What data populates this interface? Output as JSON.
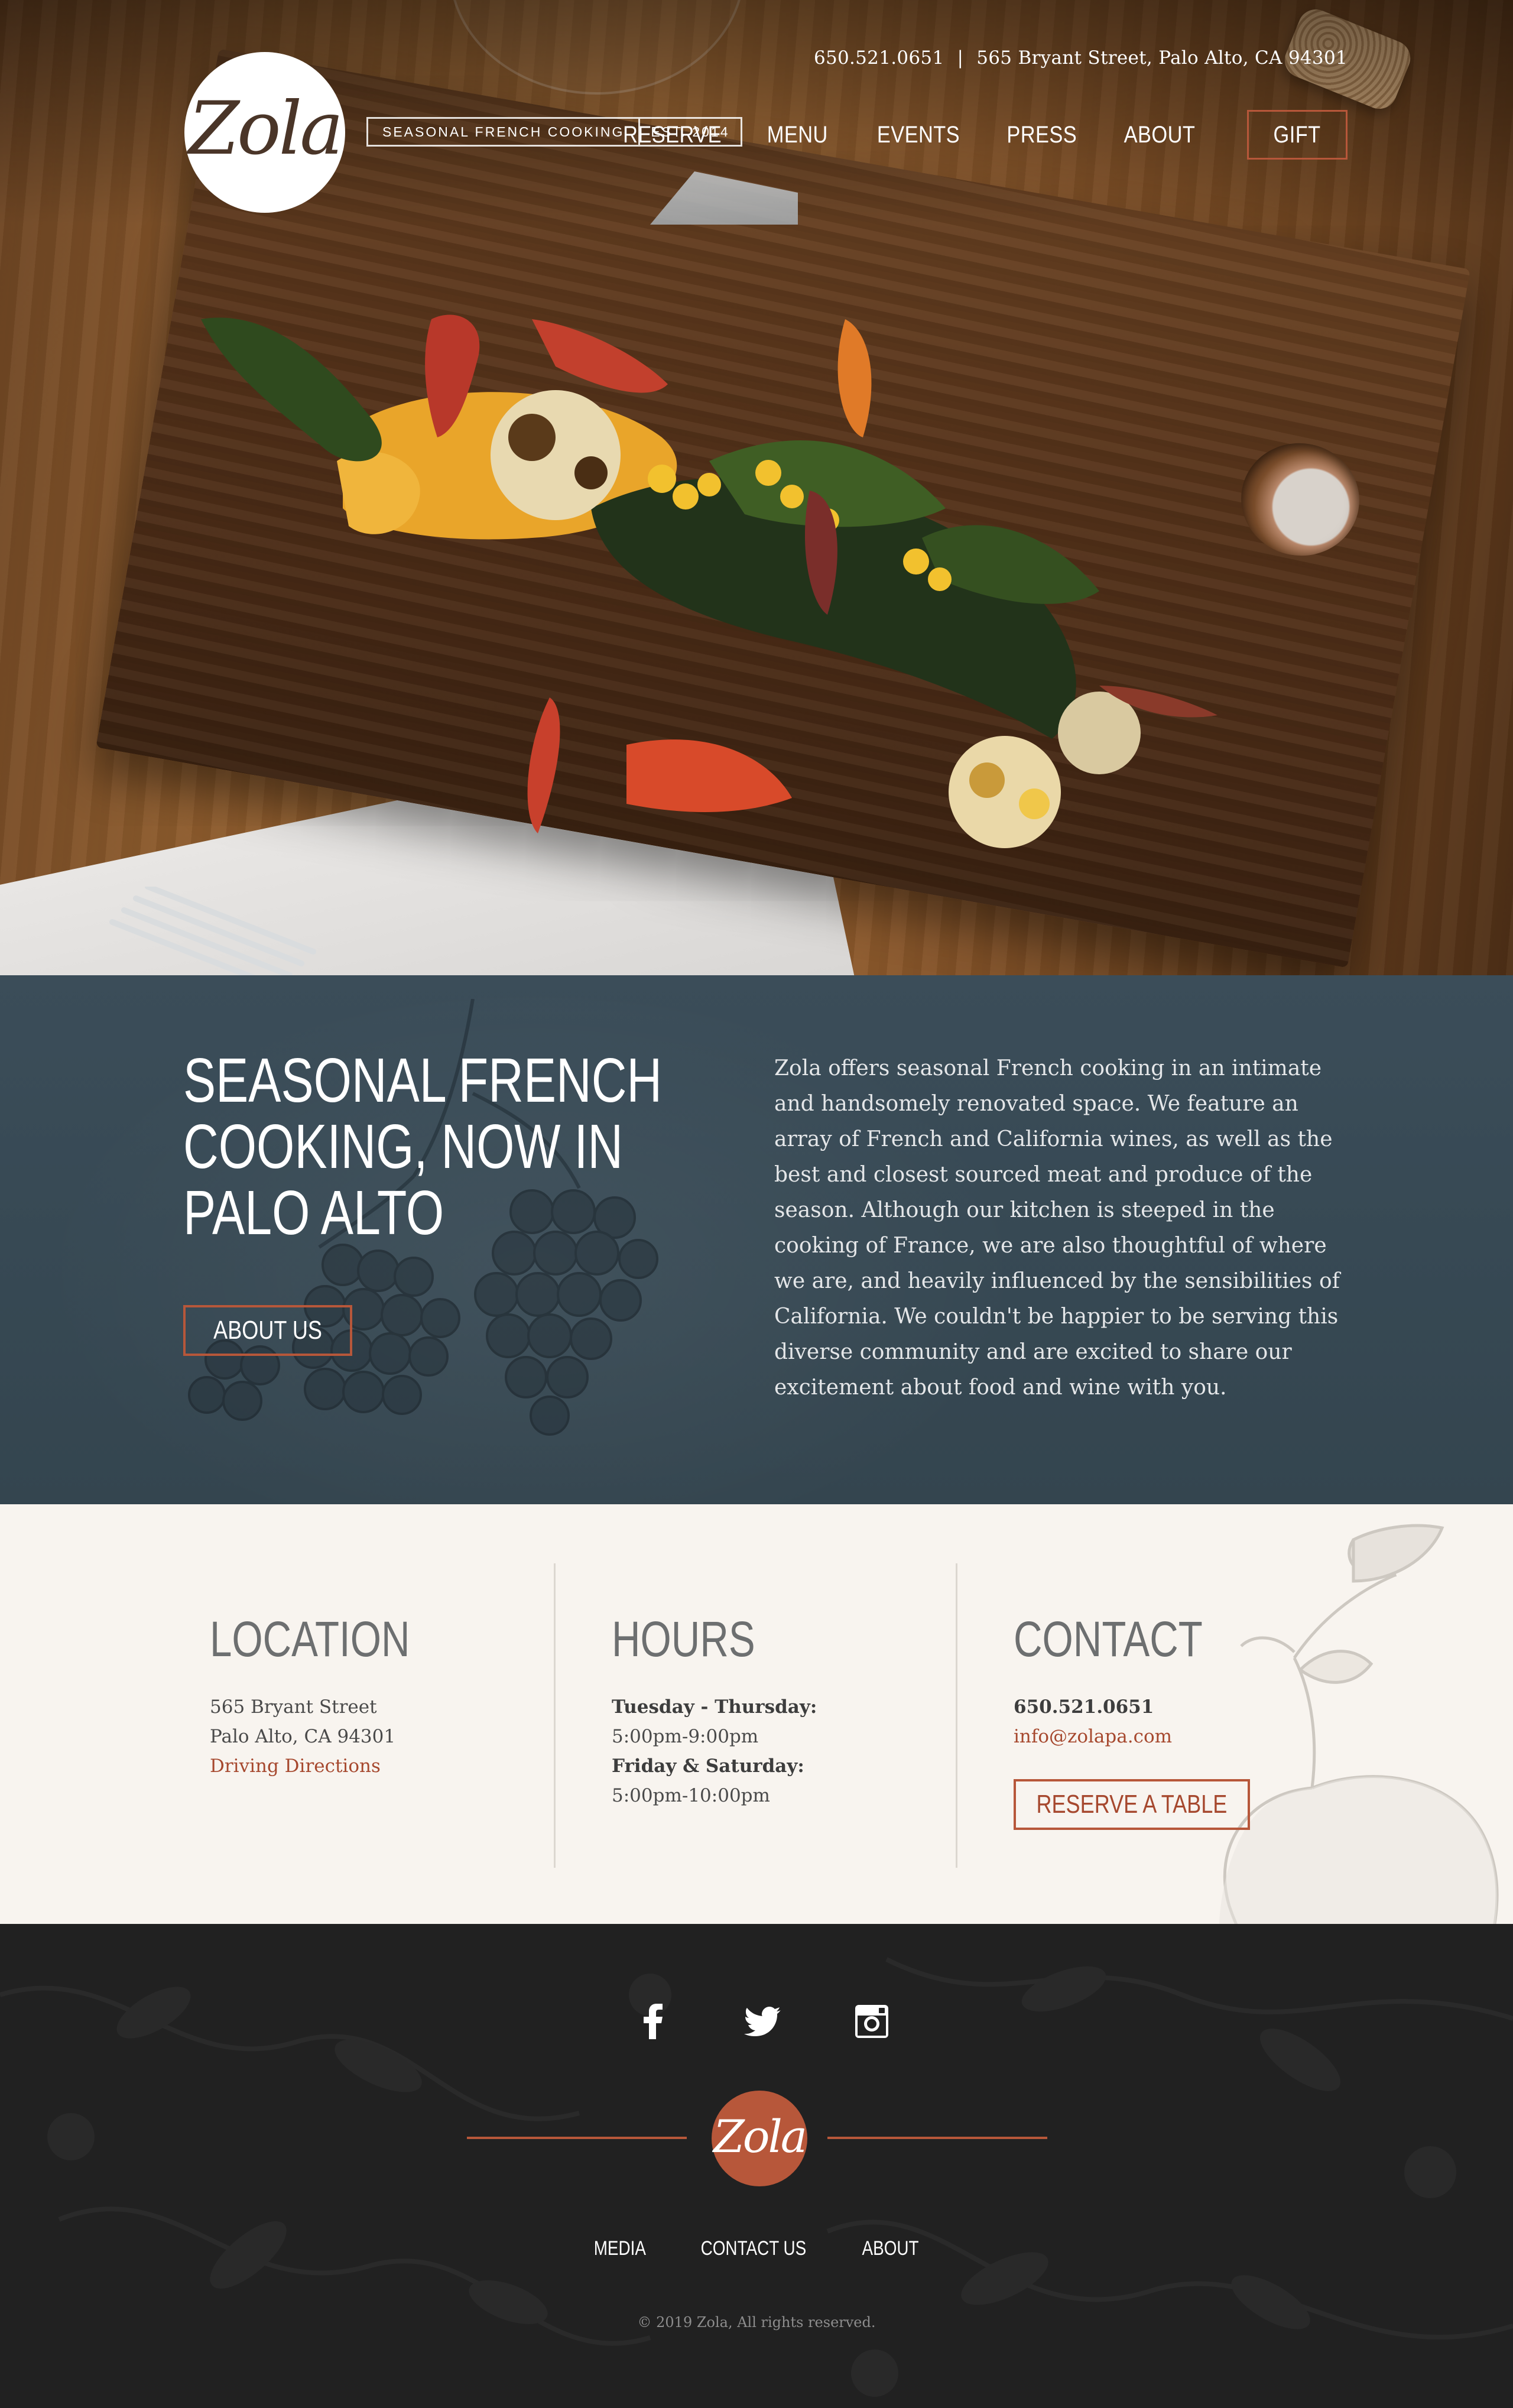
{
  "header": {
    "phone": "650.521.0651",
    "separator": "|",
    "address": "565 Bryant Street, Palo Alto, CA 94301",
    "logo_text": "Zola",
    "tagline": "SEASONAL FRENCH COOKING",
    "established": "EST. 2014",
    "nav": [
      {
        "label": "RESERVE"
      },
      {
        "label": "MENU"
      },
      {
        "label": "EVENTS"
      },
      {
        "label": "PRESS"
      },
      {
        "label": "ABOUT"
      }
    ],
    "gift_label": "GIFT"
  },
  "about": {
    "title": "SEASONAL FRENCH COOKING, NOW IN PALO ALTO",
    "button_label": "ABOUT US",
    "body": "Zola offers seasonal French cooking in an intimate and handsomely renovated space. We feature an array of French and California wines, as well as the best and closest sourced meat and produce of the season. Although our kitchen is steeped in the cooking of France, we are also thoughtful of where we are, and heavily influenced by the sensibilities of California. We couldn't be happier to be serving this diverse community and are excited to share our excitement about food and wine with you."
  },
  "location": {
    "heading": "LOCATION",
    "street": "565 Bryant Street",
    "city": "Palo Alto, CA 94301",
    "directions_label": "Driving Directions"
  },
  "hours": {
    "heading": "HOURS",
    "days1": "Tuesday - Thursday:",
    "time1": "5:00pm-9:00pm",
    "days2": "Friday & Saturday:",
    "time2": "5:00pm-10:00pm"
  },
  "contact": {
    "heading": "CONTACT",
    "phone": "650.521.0651",
    "email": "info@zolapa.com",
    "reserve_label": "RESERVE A TABLE"
  },
  "footer": {
    "social_icons": [
      "facebook-icon",
      "twitter-icon",
      "instagram-icon"
    ],
    "logo_text": "Zola",
    "links": [
      {
        "label": "MEDIA"
      },
      {
        "label": "CONTACT US"
      },
      {
        "label": "ABOUT"
      }
    ],
    "copyright": "© 2019 Zola, All rights reserved."
  },
  "colors": {
    "accent": "#b7573a",
    "about_bg": "#3b4d59",
    "info_bg": "#f8f4ef",
    "footer_bg": "#212121"
  }
}
